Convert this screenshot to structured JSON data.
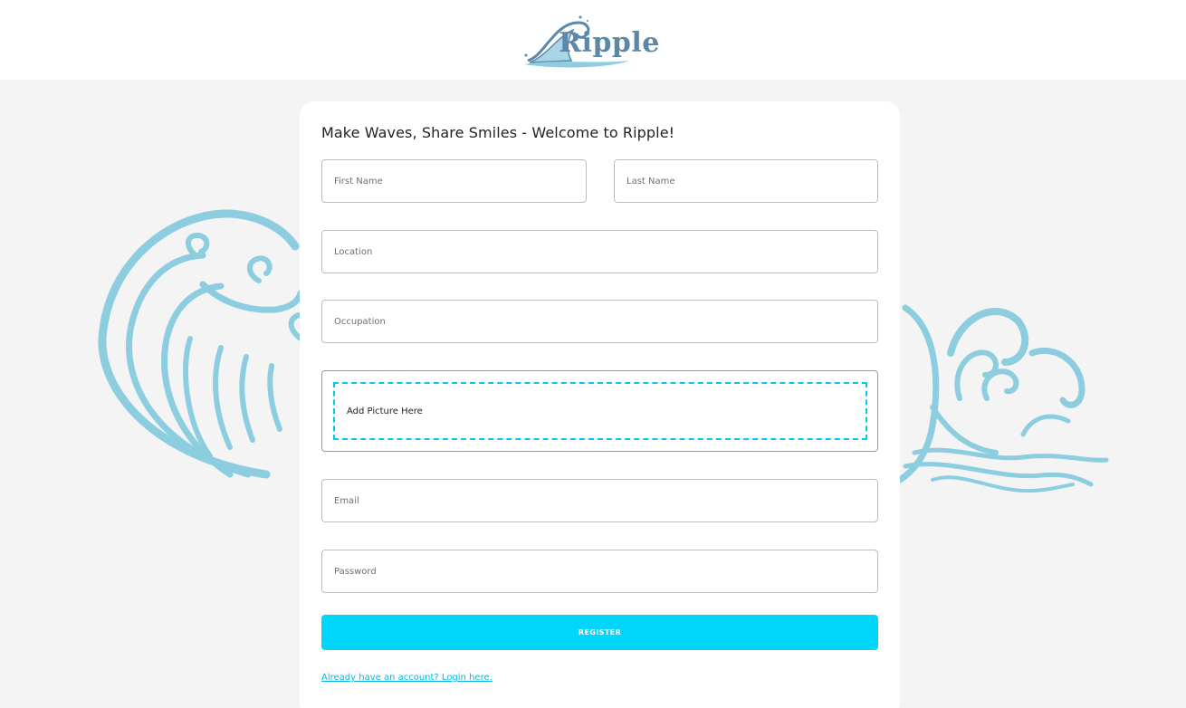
{
  "brand": {
    "name": "Ripple",
    "color": "#5b87a8",
    "wave_color": "#8ccde0"
  },
  "form": {
    "title": "Make Waves, Share Smiles - Welcome to Ripple!",
    "first_name_placeholder": "First Name",
    "last_name_placeholder": "Last Name",
    "location_placeholder": "Location",
    "occupation_placeholder": "Occupation",
    "picture_dropzone_label": "Add Picture Here",
    "email_placeholder": "Email",
    "password_placeholder": "Password",
    "register_label": "REGISTER",
    "login_link_label": "Already have an account? Login here."
  },
  "colors": {
    "accent": "#00d5fa",
    "link": "#00b7e6",
    "dashed_border": "#00c8e8"
  }
}
